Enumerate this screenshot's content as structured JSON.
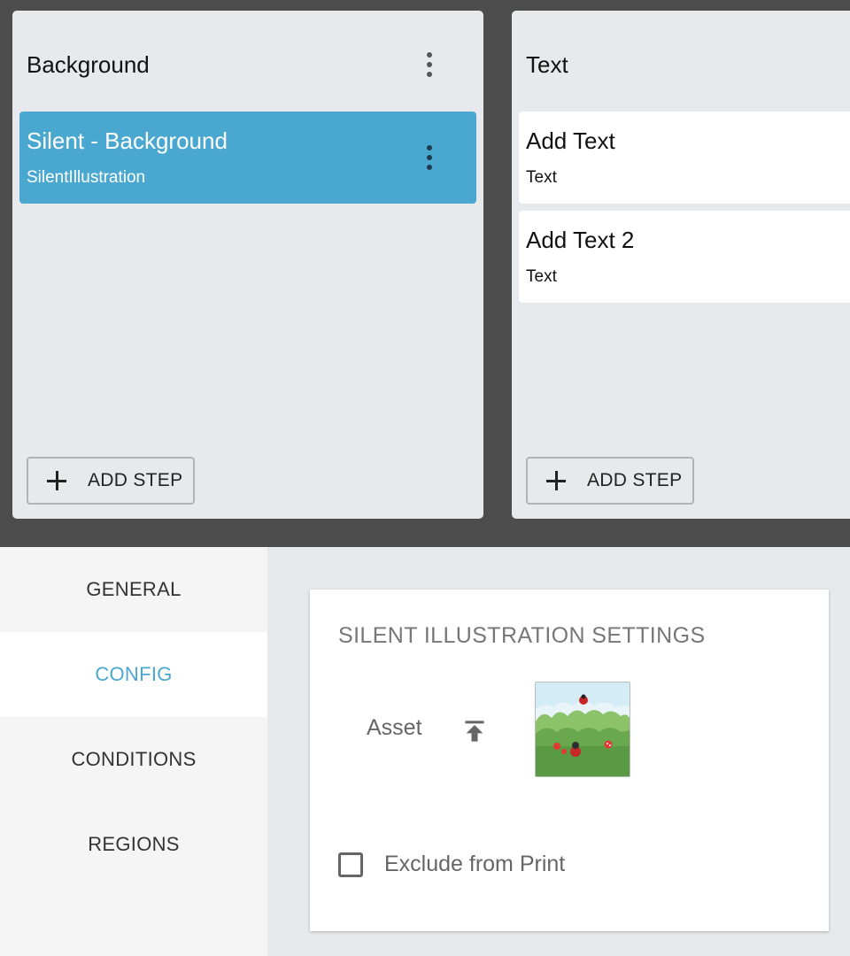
{
  "columns": [
    {
      "title": "Background",
      "steps": [
        {
          "title": "Silent - Background",
          "type": "SilentIllustration",
          "selected": true
        }
      ],
      "add_step_label": "ADD STEP"
    },
    {
      "title": "Text",
      "steps": [
        {
          "title": "Add Text",
          "type": "Text",
          "selected": false
        },
        {
          "title": "Add Text 2",
          "type": "Text",
          "selected": false
        }
      ],
      "add_step_label": "ADD STEP"
    }
  ],
  "tabs": [
    {
      "label": "GENERAL",
      "active": false
    },
    {
      "label": "CONFIG",
      "active": true
    },
    {
      "label": "CONDITIONS",
      "active": false
    },
    {
      "label": "REGIONS",
      "active": false
    }
  ],
  "settings": {
    "title": "SILENT ILLUSTRATION SETTINGS",
    "asset_label": "Asset",
    "asset_icon": "upload-icon",
    "exclude_label": "Exclude from Print",
    "exclude_checked": false
  },
  "colors": {
    "accent": "#4aa8d0",
    "board_background": "#4d4d4d",
    "column_background": "#e8e9ed"
  }
}
